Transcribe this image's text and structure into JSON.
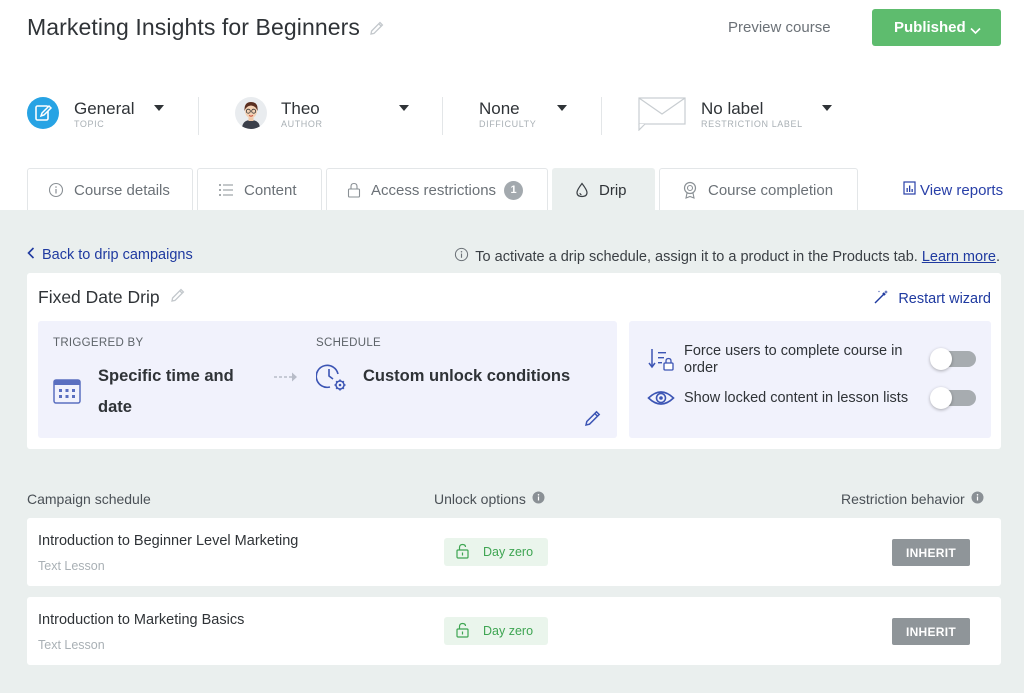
{
  "header": {
    "course_title": "Marketing Insights for Beginners",
    "preview_label": "Preview course",
    "publish_label": "Published"
  },
  "meta": {
    "topic": {
      "value": "General",
      "label": "TOPIC"
    },
    "author": {
      "value": "Theo",
      "label": "AUTHOR"
    },
    "difficulty": {
      "value": "None",
      "label": "DIFFICULTY"
    },
    "restriction": {
      "value": "No label",
      "label": "RESTRICTION LABEL"
    }
  },
  "tabs": {
    "course_details": "Course details",
    "content": "Content",
    "access_restrictions": "Access restrictions",
    "access_badge": "1",
    "drip": "Drip",
    "course_completion": "Course completion",
    "view_reports": "View reports"
  },
  "drip": {
    "back_label": "Back to drip campaigns",
    "note_text": "To activate a drip schedule, assign it to a product in the Products tab.",
    "learn_more": "Learn more",
    "period": ".",
    "campaign_title": "Fixed Date Drip",
    "restart_label": "Restart wizard",
    "triggered_label": "TRIGGERED BY",
    "triggered_line1": "Specific time and",
    "triggered_line2": "date",
    "schedule_label": "SCHEDULE",
    "schedule_value": "Custom unlock conditions",
    "option_force": "Force users to complete course in order",
    "option_show": "Show locked content in lesson lists"
  },
  "schedule": {
    "col_campaign": "Campaign schedule",
    "col_unlock": "Unlock options",
    "col_restriction": "Restriction behavior",
    "rows": [
      {
        "title": "Introduction to Beginner Level Marketing",
        "type": "Text Lesson",
        "unlock": "Day zero",
        "behavior": "INHERIT"
      },
      {
        "title": "Introduction to Marketing Basics",
        "type": "Text Lesson",
        "unlock": "Day zero",
        "behavior": "INHERIT"
      }
    ]
  },
  "colors": {
    "accent_blue": "#1f3aa0",
    "publish_green": "#5ebc6e",
    "topic_blue": "#27a3e4",
    "panel_bg": "#eaefee"
  },
  "icons": [
    "pencil-icon",
    "chevron-down-icon",
    "topic-edit-icon",
    "avatar",
    "label-envelope-icon",
    "info-icon",
    "list-icon",
    "lock-icon",
    "drop-icon",
    "award-icon",
    "report-icon",
    "chevron-left-icon",
    "magic-wand-icon",
    "calendar-icon",
    "arrow-right-icon",
    "clock-gear-icon",
    "sort-lock-icon",
    "eye-icon",
    "unlock-icon"
  ]
}
